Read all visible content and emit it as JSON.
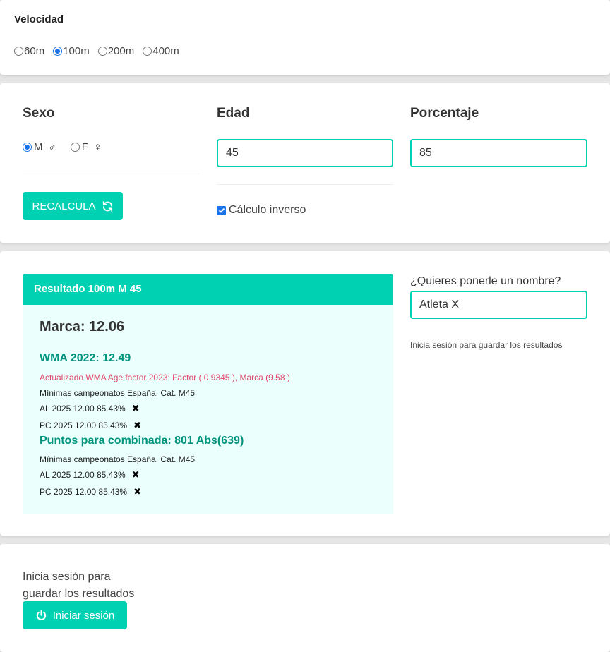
{
  "velocidad": {
    "title": "Velocidad",
    "options": [
      "60m",
      "100m",
      "200m",
      "400m"
    ],
    "selected": "100m"
  },
  "sexo": {
    "title": "Sexo",
    "options": [
      "M",
      "F"
    ],
    "symbols": [
      "♂",
      "♀"
    ],
    "selected": "M"
  },
  "recalcula_label": "RECALCULA",
  "edad": {
    "title": "Edad",
    "value": "45"
  },
  "porcentaje": {
    "title": "Porcentaje",
    "value": "85"
  },
  "calculo_inverso": {
    "label": "Cálculo inverso",
    "checked": true
  },
  "resultado": {
    "header": "Resultado 100m M 45",
    "marca": "Marca: 12.06",
    "wma": "WMA 2022: 12.49",
    "actualizado": "Actualizado WMA Age factor 2023: Factor ( 0.9345 ), Marca (9.58 )",
    "minimas_1": "Mínimas campeonatos España. Cat. M45",
    "rows_1": [
      "AL 2025 12.00 85.43%",
      "PC 2025 12.00 85.43%"
    ],
    "puntos": "Puntos para combinada: 801 Abs(639)",
    "minimas_2": "Mínimas campeonatos España. Cat. M45",
    "rows_2": [
      "AL 2025 12.00 85.43%",
      "PC 2025 12.00 85.43%"
    ],
    "x_mark": "✖"
  },
  "nombre": {
    "label": "¿Quieres ponerle un nombre?",
    "value": "Atleta X",
    "hint": "Inicia sesión para guardar los resultados"
  },
  "login": {
    "text": "Inicia sesión para guardar los resultados",
    "button_label": "Iniciar sesión"
  },
  "colors": {
    "accent": "#00d1b2",
    "accent_text": "#00947e",
    "result_bg": "#ebfffc",
    "warning_text": "#e0476b",
    "radio_blue": "#1a73e8"
  },
  "icons": [
    "refresh-icon",
    "power-icon",
    "male-symbol-icon",
    "female-symbol-icon",
    "cross-icon"
  ]
}
